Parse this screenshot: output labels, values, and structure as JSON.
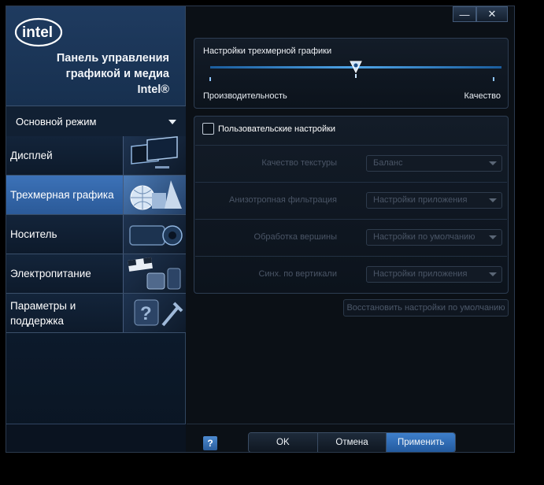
{
  "app": {
    "logo_text": "intel",
    "title_lines": [
      "Панель управления",
      "графикой и медиа",
      "Intel®"
    ]
  },
  "window_controls": {
    "minimize": "—",
    "close": "✕"
  },
  "mode": {
    "selected": "Основной режим"
  },
  "nav": {
    "items": [
      {
        "label": "Дисплей",
        "icon": "monitors-icon"
      },
      {
        "label": "Трехмерная графика",
        "icon": "3d-shapes-icon",
        "active": true
      },
      {
        "label": "Носитель",
        "icon": "projector-icon"
      },
      {
        "label": "Электропитание",
        "icon": "power-plug-icon"
      },
      {
        "label": "Параметры и поддержка",
        "icon": "help-tools-icon"
      }
    ]
  },
  "slider": {
    "title": "Настройки трехмерной графики",
    "left_label": "Производительность",
    "right_label": "Качество",
    "value_fraction": 0.5
  },
  "custom": {
    "checkbox_label": "Пользовательские настройки",
    "checked": false,
    "settings": [
      {
        "label": "Качество текстуры",
        "value": "Баланс"
      },
      {
        "label": "Анизотропная фильтрация",
        "value": "Настройки приложения"
      },
      {
        "label": "Обработка вершины",
        "value": "Настройки по умолчанию"
      },
      {
        "label": "Синх. по вертикали",
        "value": "Настройки приложения"
      }
    ],
    "restore_label": "Восстановить настройки по умолчанию"
  },
  "footer": {
    "help": "?",
    "ok": "OK",
    "cancel": "Отмена",
    "apply": "Применить"
  },
  "colors": {
    "accent": "#2f66ad",
    "background": "#0b1016"
  }
}
